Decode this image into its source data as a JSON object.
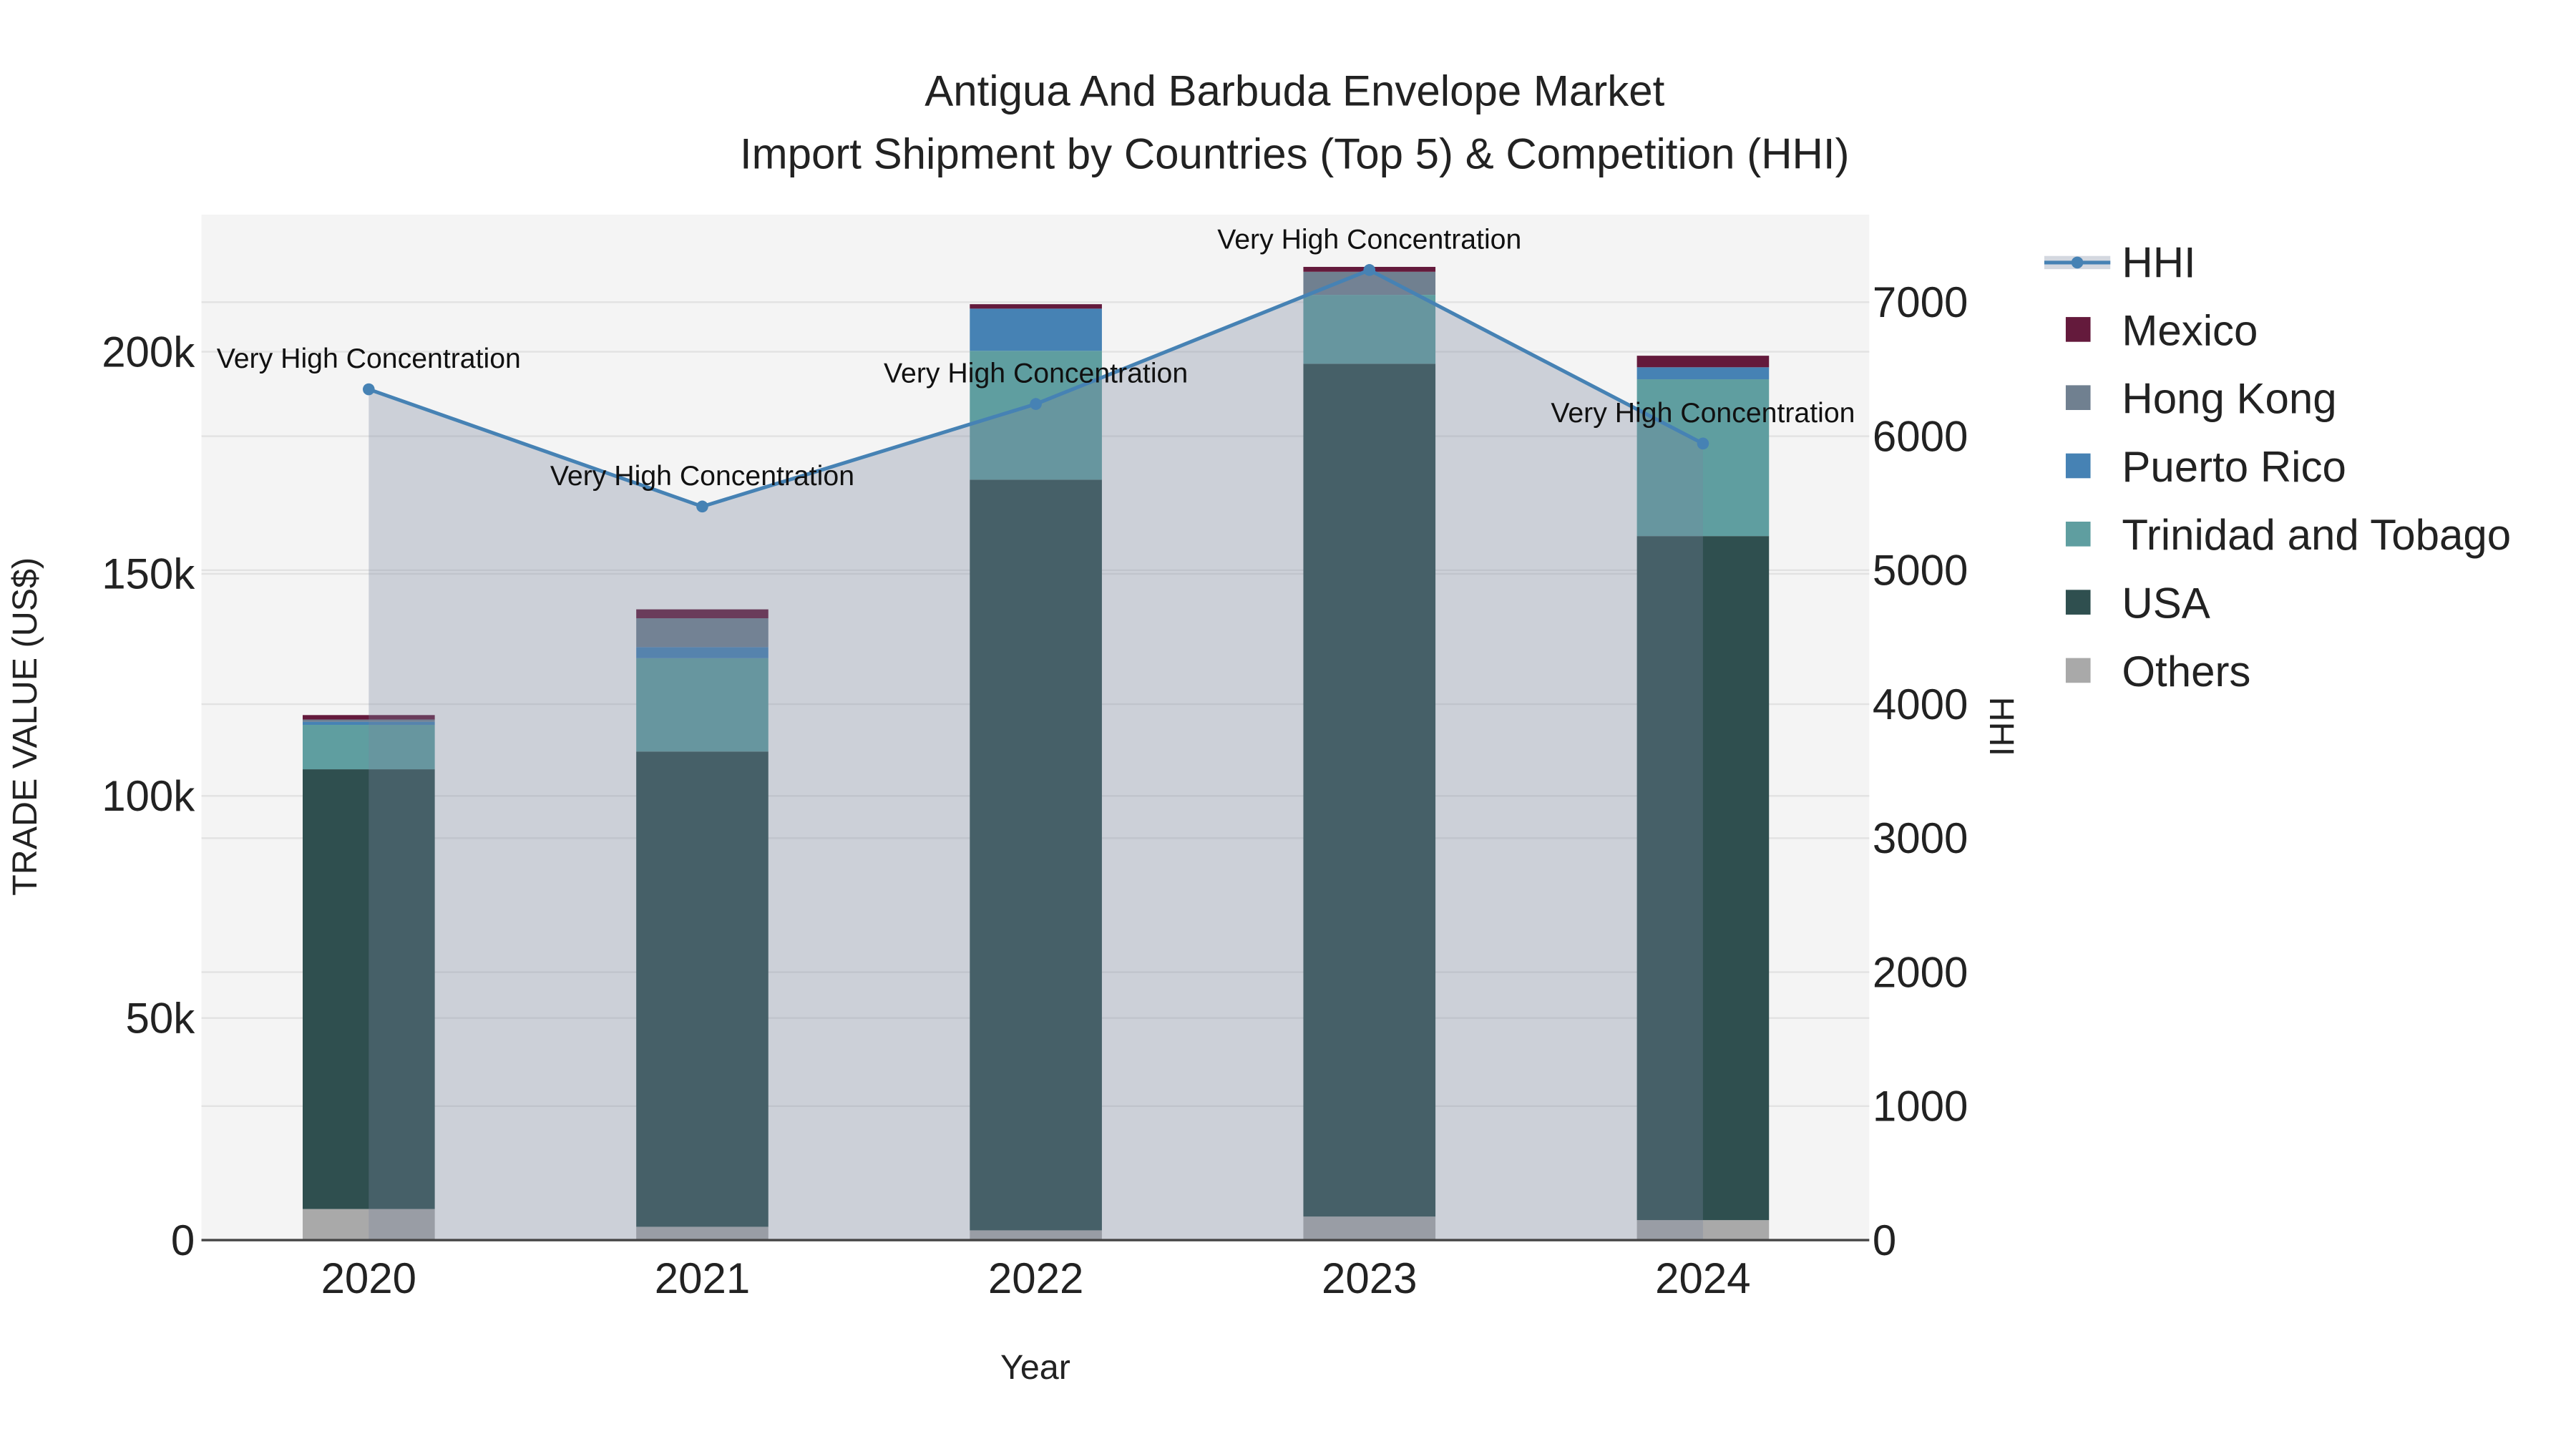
{
  "chart_data": {
    "type": "bar",
    "title": "Antigua And Barbuda Envelope Market",
    "subtitle": "Import Shipment by Countries (Top 5) & Competition (HHI)",
    "xlabel": "Year",
    "ylabel": "TRADE VALUE (US$)",
    "y2label": "HHI",
    "categories": [
      "2020",
      "2021",
      "2022",
      "2023",
      "2024"
    ],
    "ylim": [
      0,
      230000
    ],
    "y_ticks": [
      0,
      50000,
      100000,
      150000,
      200000
    ],
    "y_tick_labels": [
      "0",
      "50k",
      "100k",
      "150k",
      "200k"
    ],
    "y2lim": [
      0,
      7600
    ],
    "y2_ticks": [
      0,
      1000,
      2000,
      3000,
      4000,
      5000,
      6000,
      7000
    ],
    "y2_tick_labels": [
      "0",
      "1000",
      "2000",
      "3000",
      "4000",
      "5000",
      "6000",
      "7000"
    ],
    "stacked": true,
    "series": [
      {
        "name": "Others",
        "color": "#a9a9a9",
        "values": [
          7000,
          3000,
          2200,
          5300,
          4500
        ]
      },
      {
        "name": "USA",
        "color": "#2f4f4f",
        "values": [
          99000,
          107000,
          169000,
          192000,
          154000
        ]
      },
      {
        "name": "Trinidad and Tobago",
        "color": "#5f9ea0",
        "values": [
          10000,
          21000,
          29000,
          15500,
          35300
        ]
      },
      {
        "name": "Puerto Rico",
        "color": "#4682b4",
        "values": [
          700,
          2500,
          9500,
          0,
          2700
        ]
      },
      {
        "name": "Hong Kong",
        "color": "#708090",
        "values": [
          500,
          6500,
          0,
          5200,
          0
        ]
      },
      {
        "name": "Mexico",
        "color": "#641a3c",
        "values": [
          1000,
          2000,
          1000,
          1100,
          2600
        ]
      }
    ],
    "hhi": {
      "name": "HHI",
      "color": "#4682b4",
      "values": [
        6350,
        5475,
        6240,
        7240,
        5945
      ],
      "annotations": [
        "Very High Concentration",
        "Very High Concentration",
        "Very High Concentration",
        "Very High Concentration",
        "Very High Concentration"
      ]
    },
    "legend": [
      "HHI",
      "Mexico",
      "Hong Kong",
      "Puerto Rico",
      "Trinidad and Tobago",
      "USA",
      "Others"
    ],
    "legend_placement": "right",
    "grid": true
  }
}
